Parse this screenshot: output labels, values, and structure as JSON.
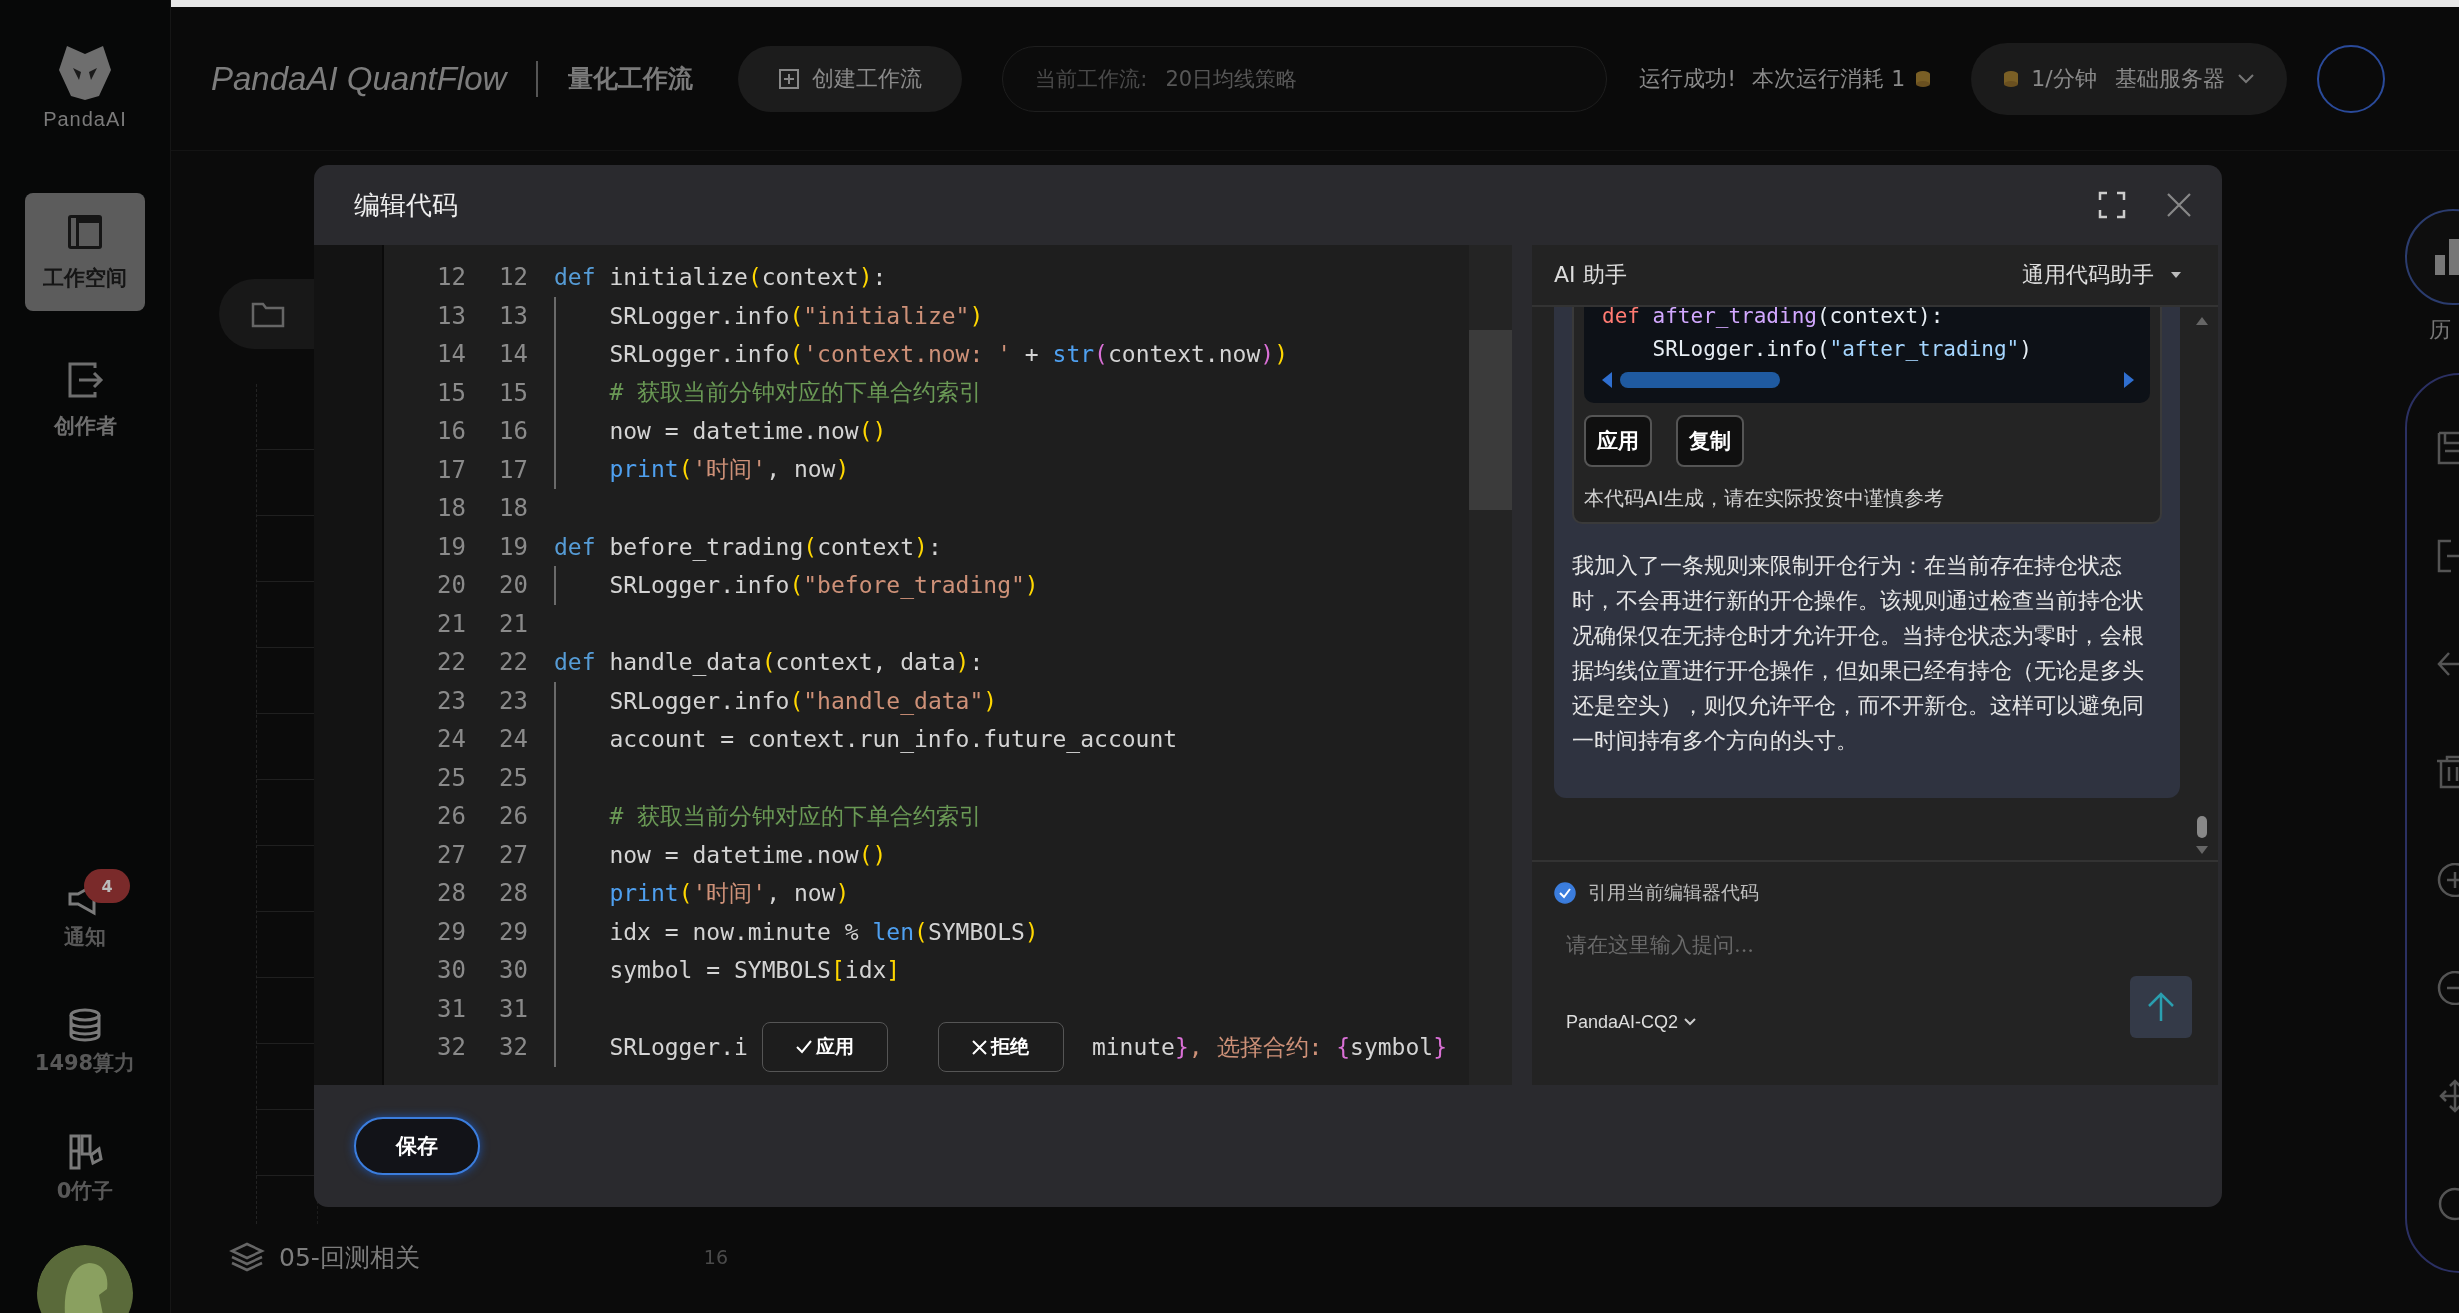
{
  "app": {
    "logo": "PandaAI",
    "title": "PandaAI QuantFlow",
    "subtitle": "量化工作流"
  },
  "sidebar": {
    "items": [
      {
        "label": "工作空间",
        "selected": true
      },
      {
        "label": "创作者",
        "selected": false
      }
    ],
    "bottom": [
      {
        "label": "通知",
        "badge": "4"
      },
      {
        "label": "1498算力"
      },
      {
        "label": "0竹子"
      }
    ]
  },
  "toolbar": {
    "create_button": "创建工作流",
    "workflow_label": "当前工作流:",
    "workflow_name": "20日均线策略",
    "status": "运行成功!",
    "cost": "本次运行消耗 1",
    "server_rate": "1/分钟",
    "server_name": "基础服务器"
  },
  "background": {
    "group": {
      "name": "05-回测相关",
      "count": "16"
    },
    "history_label": "历"
  },
  "modal": {
    "title": "编辑代码",
    "save_button": "保存",
    "inline_actions": [
      "应用",
      "拒绝"
    ],
    "lines": [
      {
        "n1": "12",
        "n2": "12",
        "guide": false,
        "tokens": [
          {
            "t": "def",
            "kind": "kw"
          },
          {
            "t": " initialize",
            "kind": "tx"
          },
          {
            "t": "(",
            "kind": "p1"
          },
          {
            "t": "context",
            "kind": "tx"
          },
          {
            "t": ")",
            "kind": "p1"
          },
          {
            "t": ":",
            "kind": "tx"
          }
        ]
      },
      {
        "n1": "13",
        "n2": "13",
        "guide": true,
        "tokens": [
          {
            "t": "    SRLogger.info",
            "kind": "tx"
          },
          {
            "t": "(",
            "kind": "p1"
          },
          {
            "t": "\"initialize\"",
            "kind": "str"
          },
          {
            "t": ")",
            "kind": "p1"
          }
        ]
      },
      {
        "n1": "14",
        "n2": "14",
        "guide": true,
        "tokens": [
          {
            "t": "    SRLogger.info",
            "kind": "tx"
          },
          {
            "t": "(",
            "kind": "p1"
          },
          {
            "t": "'context.now: '",
            "kind": "str"
          },
          {
            "t": " + ",
            "kind": "tx"
          },
          {
            "t": "str",
            "kind": "bi"
          },
          {
            "t": "(",
            "kind": "p2"
          },
          {
            "t": "context.now",
            "kind": "tx"
          },
          {
            "t": ")",
            "kind": "p2"
          },
          {
            "t": ")",
            "kind": "p1"
          }
        ]
      },
      {
        "n1": "15",
        "n2": "15",
        "guide": true,
        "tokens": [
          {
            "t": "    # 获取当前分钟对应的下单合约索引",
            "kind": "cm"
          }
        ]
      },
      {
        "n1": "16",
        "n2": "16",
        "guide": true,
        "tokens": [
          {
            "t": "    now = datetime.now",
            "kind": "tx"
          },
          {
            "t": "()",
            "kind": "p1"
          }
        ]
      },
      {
        "n1": "17",
        "n2": "17",
        "guide": true,
        "tokens": [
          {
            "t": "    print",
            "kind": "bi"
          },
          {
            "t": "(",
            "kind": "p1"
          },
          {
            "t": "'时间'",
            "kind": "str"
          },
          {
            "t": ", now",
            "kind": "tx"
          },
          {
            "t": ")",
            "kind": "p1"
          }
        ]
      },
      {
        "n1": "18",
        "n2": "18",
        "guide": false
      },
      {
        "n1": "19",
        "n2": "19",
        "guide": false,
        "tokens": [
          {
            "t": "def",
            "kind": "kw"
          },
          {
            "t": " before_trading",
            "kind": "tx"
          },
          {
            "t": "(",
            "kind": "p1"
          },
          {
            "t": "context",
            "kind": "tx"
          },
          {
            "t": ")",
            "kind": "p1"
          },
          {
            "t": ":",
            "kind": "tx"
          }
        ]
      },
      {
        "n1": "20",
        "n2": "20",
        "guide": true,
        "tokens": [
          {
            "t": "    SRLogger.info",
            "kind": "tx"
          },
          {
            "t": "(",
            "kind": "p1"
          },
          {
            "t": "\"before_trading\"",
            "kind": "str"
          },
          {
            "t": ")",
            "kind": "p1"
          }
        ]
      },
      {
        "n1": "21",
        "n2": "21",
        "guide": false
      },
      {
        "n1": "22",
        "n2": "22",
        "guide": false,
        "tokens": [
          {
            "t": "def",
            "kind": "kw"
          },
          {
            "t": " handle_data",
            "kind": "tx"
          },
          {
            "t": "(",
            "kind": "p1"
          },
          {
            "t": "context, data",
            "kind": "tx"
          },
          {
            "t": ")",
            "kind": "p1"
          },
          {
            "t": ":",
            "kind": "tx"
          }
        ]
      },
      {
        "n1": "23",
        "n2": "23",
        "guide": true,
        "tokens": [
          {
            "t": "    SRLogger.info",
            "kind": "tx"
          },
          {
            "t": "(",
            "kind": "p1"
          },
          {
            "t": "\"handle_data\"",
            "kind": "str"
          },
          {
            "t": ")",
            "kind": "p1"
          }
        ]
      },
      {
        "n1": "24",
        "n2": "24",
        "guide": true,
        "tokens": [
          {
            "t": "    account = context.run_info.future_account",
            "kind": "tx"
          }
        ]
      },
      {
        "n1": "25",
        "n2": "25",
        "guide": true
      },
      {
        "n1": "26",
        "n2": "26",
        "guide": true,
        "tokens": [
          {
            "t": "    # 获取当前分钟对应的下单合约索引",
            "kind": "cm"
          }
        ]
      },
      {
        "n1": "27",
        "n2": "27",
        "guide": true,
        "tokens": [
          {
            "t": "    now = datetime.now",
            "kind": "tx"
          },
          {
            "t": "()",
            "kind": "p1"
          }
        ]
      },
      {
        "n1": "28",
        "n2": "28",
        "guide": true,
        "tokens": [
          {
            "t": "    print",
            "kind": "bi"
          },
          {
            "t": "(",
            "kind": "p1"
          },
          {
            "t": "'时间'",
            "kind": "str"
          },
          {
            "t": ", now",
            "kind": "tx"
          },
          {
            "t": ")",
            "kind": "p1"
          }
        ]
      },
      {
        "n1": "29",
        "n2": "29",
        "guide": true,
        "tokens": [
          {
            "t": "    idx = now.minute % ",
            "kind": "tx"
          },
          {
            "t": "len",
            "kind": "bi"
          },
          {
            "t": "(",
            "kind": "p1"
          },
          {
            "t": "SYMBOLS",
            "kind": "tx"
          },
          {
            "t": ")",
            "kind": "p1"
          }
        ]
      },
      {
        "n1": "30",
        "n2": "30",
        "guide": true,
        "tokens": [
          {
            "t": "    symbol = SYMBOLS",
            "kind": "tx"
          },
          {
            "t": "[",
            "kind": "p1"
          },
          {
            "t": "idx",
            "kind": "tx"
          },
          {
            "t": "]",
            "kind": "p1"
          }
        ]
      },
      {
        "n1": "31",
        "n2": "31",
        "guide": true
      },
      {
        "n1": "32",
        "n2": "32",
        "guide": true,
        "tokens": [
          {
            "t": "    SRLogger.i",
            "kind": "tx"
          }
        ],
        "after_tokens": [
          {
            "t": "minute",
            "kind": "tx"
          },
          {
            "t": "}",
            "kind": "p2"
          },
          {
            "t": ", 选择合约: ",
            "kind": "str"
          },
          {
            "t": "{",
            "kind": "p2"
          },
          {
            "t": "symbol",
            "kind": "tx"
          },
          {
            "t": "}",
            "kind": "p2"
          }
        ]
      }
    ]
  },
  "assistant": {
    "title": "AI 助手",
    "mode": "通用代码助手",
    "code": [
      [
        {
          "t": "def ",
          "kind": "kw"
        },
        {
          "t": "after_trading",
          "kind": "fn"
        },
        {
          "t": "(context):",
          "kind": "tx"
        }
      ],
      [
        {
          "t": "    SRLogger.info(",
          "kind": "tx"
        },
        {
          "t": "\"after_trading\"",
          "kind": "str"
        },
        {
          "t": ")",
          "kind": "tx"
        }
      ]
    ],
    "code_buttons": [
      "应用",
      "复制"
    ],
    "disclaimer": "本代码AI生成，请在实际投资中谨慎参考",
    "reply": "我加入了一条规则来限制开仓行为：在当前存在持仓状态时，不会再进行新的开仓操作。该规则通过检查当前持仓状况确保仅在无持仓时才允许开仓。当持仓状态为零时，会根据均线位置进行开仓操作，但如果已经有持仓（无论是多头还是空头），则仅允许平仓，而不开新仓。这样可以避免同一时间持有多个方向的头寸。",
    "quote": {
      "label": "引用当前编辑器代码",
      "checked": true
    },
    "placeholder": "请在这里输入提问...",
    "model": "PandaAI-CQ2"
  }
}
